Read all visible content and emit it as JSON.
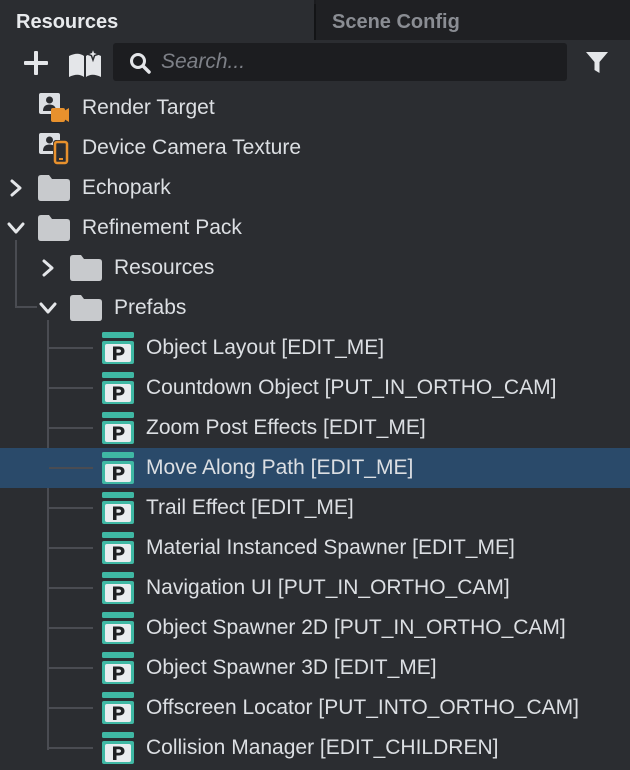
{
  "tabs": {
    "resources": "Resources",
    "scene_config": "Scene Config"
  },
  "toolbar": {
    "search_placeholder": "Search..."
  },
  "colors": {
    "selection": "#2a4a6a",
    "prefab_teal": "#3fb8a4",
    "camera_orange": "#e8912d",
    "folder_gray": "#c8cacd"
  },
  "tree": {
    "render_target": "Render Target",
    "device_camera_texture": "Device Camera Texture",
    "echopark": "Echopark",
    "refinement_pack": "Refinement Pack",
    "resources_folder": "Resources",
    "prefabs_folder": "Prefabs",
    "prefabs": [
      "Object Layout [EDIT_ME]",
      "Countdown Object [PUT_IN_ORTHO_CAM]",
      "Zoom Post Effects [EDIT_ME]",
      "Move Along Path [EDIT_ME]",
      "Trail Effect [EDIT_ME]",
      "Material Instanced Spawner [EDIT_ME]",
      "Navigation UI [PUT_IN_ORTHO_CAM]",
      "Object Spawner 2D [PUT_IN_ORTHO_CAM]",
      "Object Spawner 3D [EDIT_ME]",
      "Offscreen Locator [PUT_INTO_ORTHO_CAM]",
      "Collision Manager [EDIT_CHILDREN]"
    ],
    "selected_prefab": "Move Along Path [EDIT_ME]"
  }
}
